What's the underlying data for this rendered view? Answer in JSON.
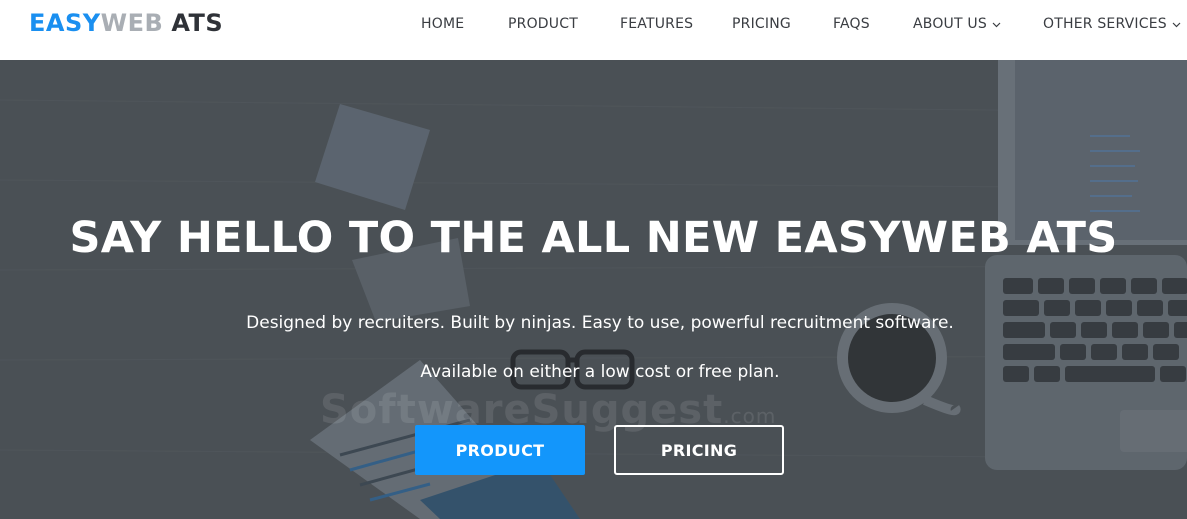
{
  "brand": {
    "logo_part1": "EASY",
    "logo_part2": "WEB",
    "logo_part3": "ATS",
    "color_primary": "#1a8ff0",
    "color_secondary": "#a9aeb4",
    "color_dark": "#2f3238"
  },
  "nav": {
    "items": [
      {
        "label": "HOME",
        "has_dropdown": false
      },
      {
        "label": "PRODUCT",
        "has_dropdown": false
      },
      {
        "label": "FEATURES",
        "has_dropdown": false
      },
      {
        "label": "PRICING",
        "has_dropdown": false
      },
      {
        "label": "FAQS",
        "has_dropdown": false
      },
      {
        "label": "ABOUT US",
        "has_dropdown": true
      },
      {
        "label": "OTHER SERVICES",
        "has_dropdown": true
      }
    ]
  },
  "hero": {
    "title": "SAY HELLO TO THE ALL NEW EASYWEB ATS",
    "subtitle_line1": "Designed by recruiters. Built by ninjas. Easy to use, powerful recruitment software.",
    "subtitle_line2": "Available on either a low cost or free plan.",
    "primary_button_label": "PRODUCT",
    "secondary_button_label": "PRICING",
    "primary_button_color": "#1396fb",
    "watermark_main": "SoftwareSuggest",
    "watermark_suffix": ".com"
  }
}
